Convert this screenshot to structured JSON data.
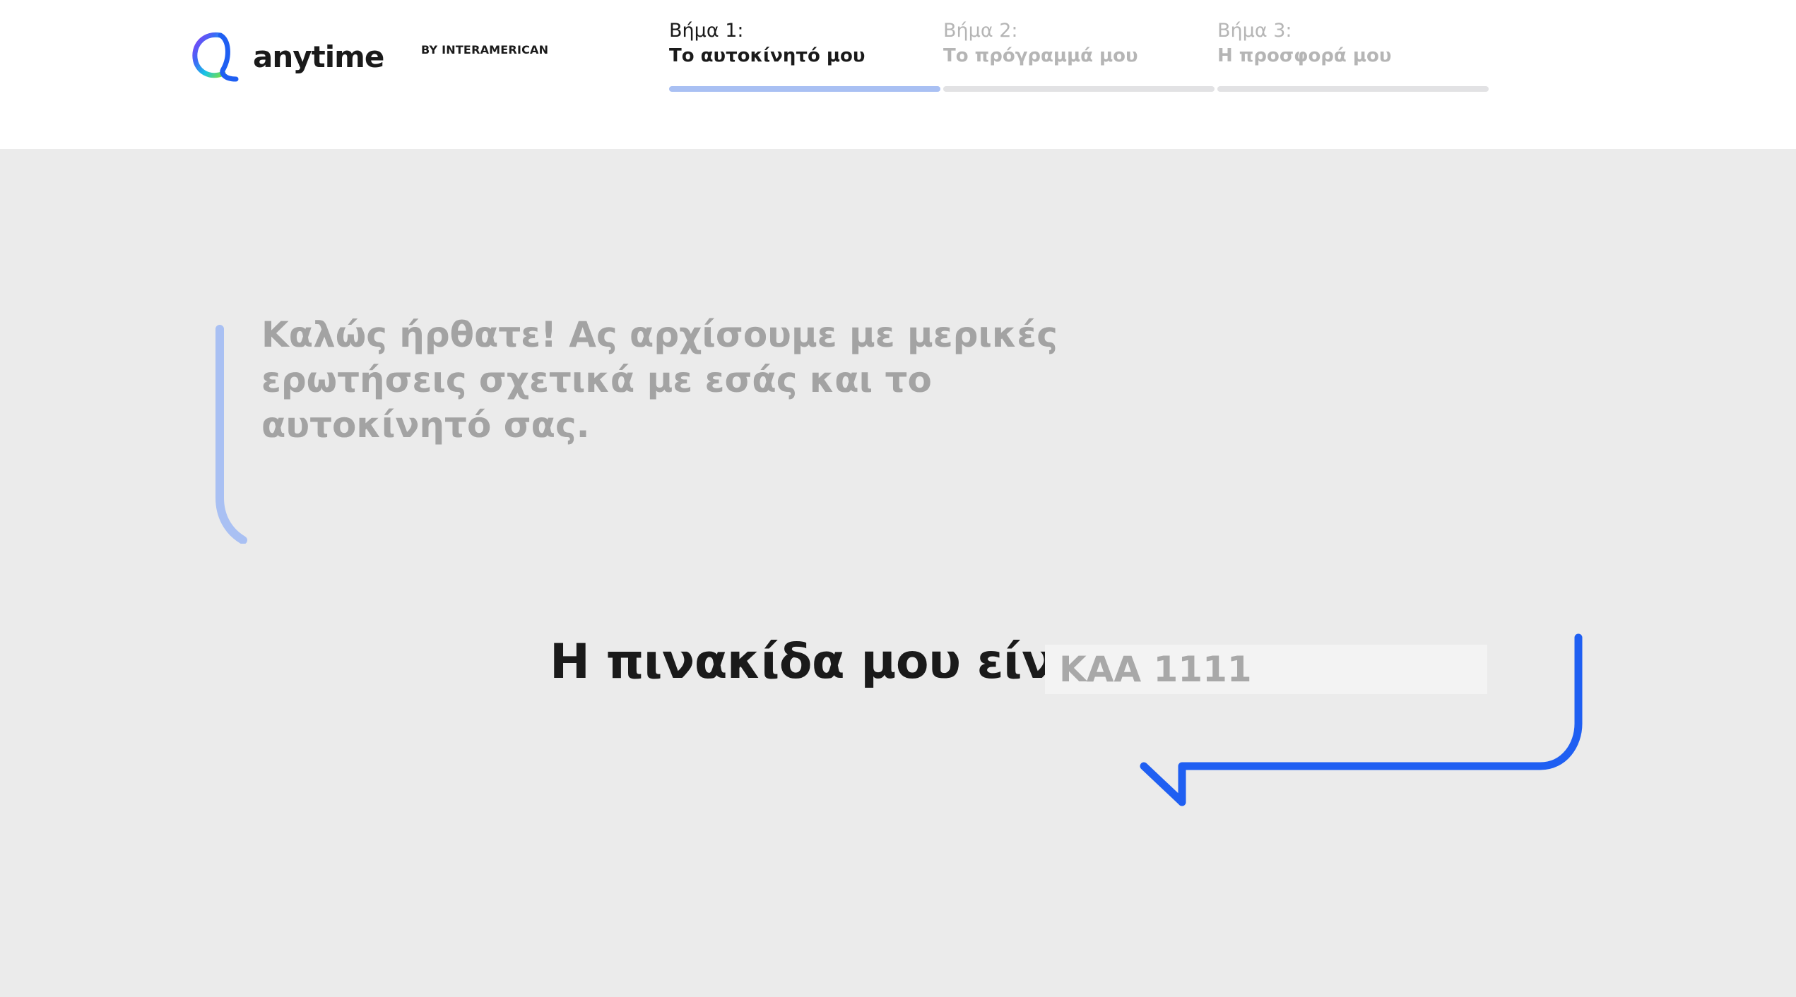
{
  "brand": {
    "name": "anytime",
    "by": "BY INTERAMERICAN"
  },
  "steps": [
    {
      "number": "Βήμα 1:",
      "title": "Το αυτοκίνητό μου",
      "active": true
    },
    {
      "number": "Βήμα 2:",
      "title": "Το πρόγραμμά μου",
      "active": false
    },
    {
      "number": "Βήμα 3:",
      "title": "Η προσφορά μου",
      "active": false
    }
  ],
  "intro": {
    "text": "Καλώς ήρθατε! Ας αρχίσουμε με μερικές ερωτήσεις σχετικά με εσάς και το αυτοκίνητό σας."
  },
  "plate": {
    "label": "Η πινακίδα μου είναι",
    "placeholder": "ΚΑΑ 1111",
    "value": ""
  },
  "colors": {
    "accent": "#1f5ff2",
    "accent_light": "#a9c0f3",
    "inactive_bar": "#e2e2e4",
    "background": "#ebebeb",
    "header_bg": "#ffffff"
  }
}
